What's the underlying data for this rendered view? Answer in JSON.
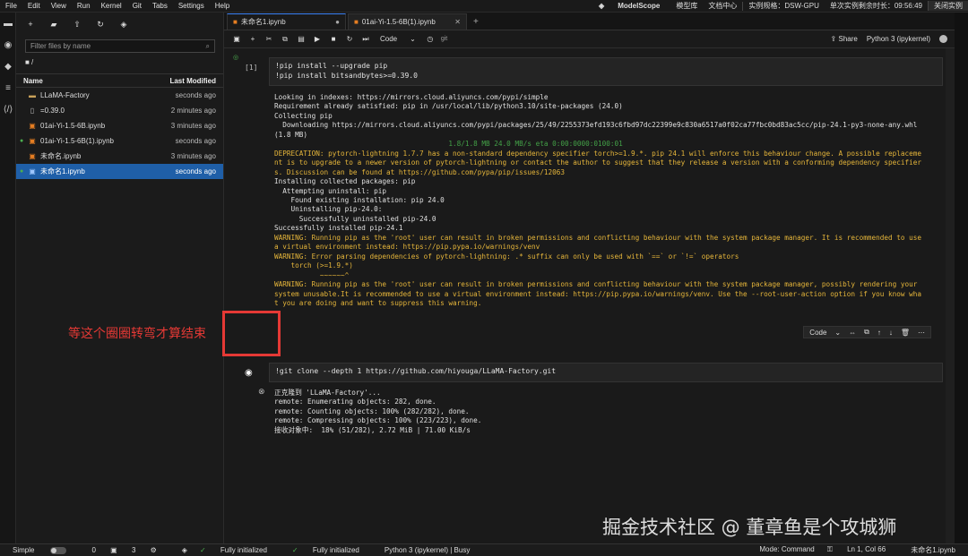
{
  "menubar": {
    "items": [
      "File",
      "Edit",
      "View",
      "Run",
      "Kernel",
      "Git",
      "Tabs",
      "Settings",
      "Help"
    ],
    "brand": "ModelScope",
    "links": [
      "模型库",
      "文档中心"
    ],
    "instance_spec": "实例规格：DSW-GPU",
    "remaining_time": "单次实例剩余时长：09:56:49",
    "close_instance": "关闭实例"
  },
  "filebrowser": {
    "search_placeholder": "Filter files by name",
    "path": "■ /",
    "col_name": "Name",
    "col_modified": "Last Modified",
    "files": [
      {
        "name": "LLaMA-Factory",
        "modified": "seconds ago",
        "type": "folder",
        "running": false,
        "selected": false
      },
      {
        "name": "=0.39.0",
        "modified": "2 minutes ago",
        "type": "file",
        "running": false,
        "selected": false
      },
      {
        "name": "01ai-Yi-1.5-6B.ipynb",
        "modified": "3 minutes ago",
        "type": "notebook",
        "running": false,
        "selected": false
      },
      {
        "name": "01ai-Yi-1.5-6B(1).ipynb",
        "modified": "seconds ago",
        "type": "notebook",
        "running": true,
        "selected": false
      },
      {
        "name": "未命名.ipynb",
        "modified": "3 minutes ago",
        "type": "notebook",
        "running": false,
        "selected": false
      },
      {
        "name": "未命名1.ipynb",
        "modified": "seconds ago",
        "type": "notebook",
        "running": true,
        "selected": true
      }
    ]
  },
  "tabs": [
    {
      "label": "未命名1.ipynb",
      "active": true
    },
    {
      "label": "01ai-Yi-1.5-6B(1).ipynb",
      "active": false
    }
  ],
  "toolbar": {
    "cell_type": "Code",
    "git": "git",
    "share": "Share",
    "kernel": "Python 3 (ipykernel)"
  },
  "cell1": {
    "prompt": "[1]",
    "input": [
      "!pip install --upgrade pip",
      "!pip install bitsandbytes>=0.39.0"
    ],
    "output": [
      {
        "t": "Looking in indexes: https://mirrors.cloud.aliyuncs.com/pypi/simple",
        "s": "plain"
      },
      {
        "t": "Requirement already satisfied: pip in /usr/local/lib/python3.10/site-packages (24.0)",
        "s": "plain"
      },
      {
        "t": "Collecting pip",
        "s": "plain"
      },
      {
        "t": "  Downloading https://mirrors.cloud.aliyuncs.com/pypi/packages/25/49/2255373efd193c6fbd97dc22399e9c830a6517a0f02ca77fbc0bd83ac5cc/pip-24.1-py3-none-any.whl",
        "s": "plain"
      },
      {
        "t": "(1.8 MB)",
        "s": "plain"
      },
      {
        "t": "                                          1.8/1.8 MB 24.0 MB/s eta 0:00:0000:0100:01",
        "s": "progress"
      },
      {
        "t": "DEPRECATION: pytorch-lightning 1.7.7 has a non-standard dependency specifier torch>=1.9.*. pip 24.1 will enforce this behaviour change. A possible replaceme",
        "s": "warn"
      },
      {
        "t": "nt is to upgrade to a newer version of pytorch-lightning or contact the author to suggest that they release a version with a conforming dependency specifier",
        "s": "warn"
      },
      {
        "t": "s. Discussion can be found at https://github.com/pypa/pip/issues/12063",
        "s": "warn"
      },
      {
        "t": "Installing collected packages: pip",
        "s": "plain"
      },
      {
        "t": "  Attempting uninstall: pip",
        "s": "plain"
      },
      {
        "t": "    Found existing installation: pip 24.0",
        "s": "plain"
      },
      {
        "t": "    Uninstalling pip-24.0:",
        "s": "plain"
      },
      {
        "t": "      Successfully uninstalled pip-24.0",
        "s": "plain"
      },
      {
        "t": "Successfully installed pip-24.1",
        "s": "plain"
      },
      {
        "t": "WARNING: Running pip as the 'root' user can result in broken permissions and conflicting behaviour with the system package manager. It is recommended to use",
        "s": "warn"
      },
      {
        "t": "a virtual environment instead: https://pip.pypa.io/warnings/venv",
        "s": "warn"
      },
      {
        "t": "WARNING: Error parsing dependencies of pytorch-lightning: .* suffix can only be used with `==` or `!=` operators",
        "s": "warn"
      },
      {
        "t": "    torch (>=1.9.*)",
        "s": "warn"
      },
      {
        "t": "           ~~~~~~^",
        "s": "warn"
      },
      {
        "t": "WARNING: Running pip as the 'root' user can result in broken permissions and conflicting behaviour with the system package manager, possibly rendering your",
        "s": "warn"
      },
      {
        "t": "system unusable.It is recommended to use a virtual environment instead: https://pip.pypa.io/warnings/venv. Use the --root-user-action option if you know wha",
        "s": "warn"
      },
      {
        "t": "t you are doing and want to suppress this warning.",
        "s": "warn"
      }
    ]
  },
  "cell2": {
    "input": "!git clone --depth 1 https://github.com/hiyouga/LLaMA-Factory.git",
    "cell_type": "Code",
    "output": [
      "正克隆到 'LLaMA-Factory'...",
      "remote: Enumerating objects: 282, done.",
      "remote: Counting objects: 100% (282/282), done.",
      "remote: Compressing objects: 100% (223/223), done.",
      "接收对象中:  18% (51/282), 2.72 MiB | 71.00 KiB/s"
    ]
  },
  "annotation": "等这个圈圈转弯才算结束",
  "watermark": "掘金技术社区 @ 董章鱼是个攻城狮",
  "statusbar": {
    "simple": "Simple",
    "count_a": "0",
    "count_b": "3",
    "status1": "Fully initialized",
    "status2": "Fully initialized",
    "kernel_status": "Python 3 (ipykernel) | Busy",
    "mode": "Mode: Command",
    "position": "Ln 1, Col 66",
    "filename": "未命名1.ipynb"
  },
  "colors": {
    "accent": "#1f5fa8",
    "warning": "#e5b53a",
    "annotation": "#e53935",
    "link": "#6aa6e6"
  }
}
